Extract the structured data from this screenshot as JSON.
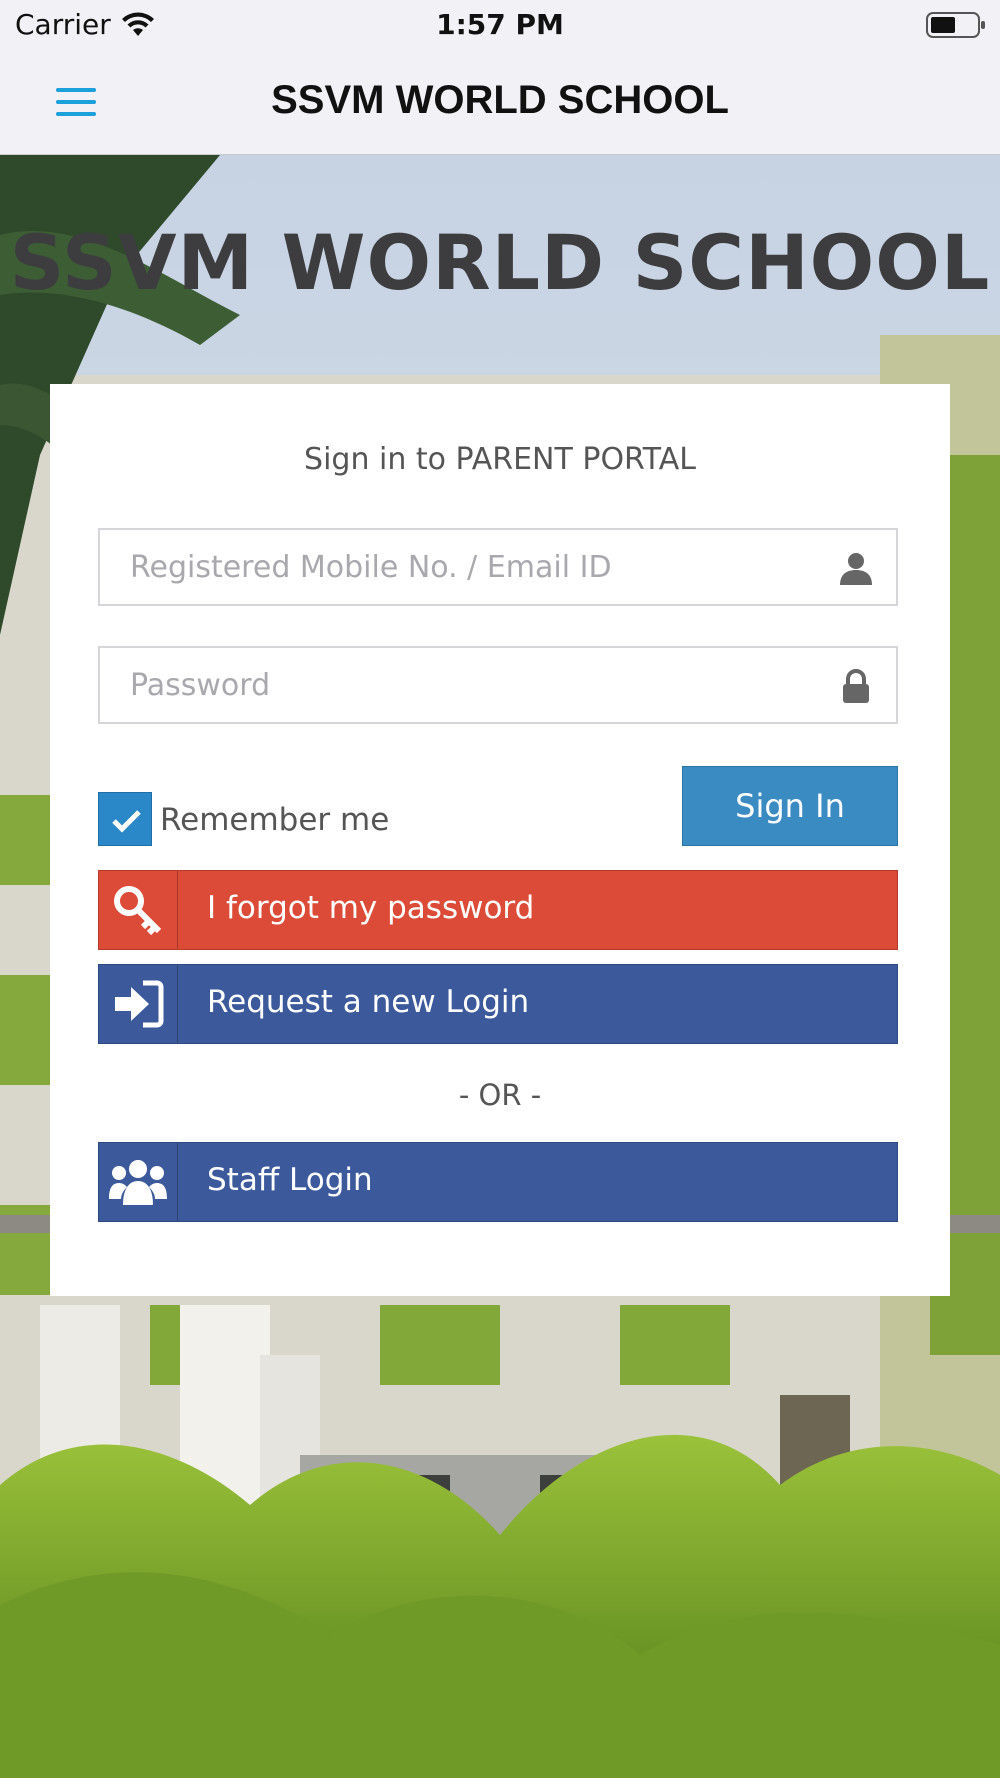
{
  "status_bar": {
    "carrier": "Carrier",
    "time": "1:57 PM"
  },
  "nav": {
    "title": "SSVM WORLD SCHOOL",
    "menu_icon": "hamburger-menu-icon"
  },
  "hero": {
    "title": "SSVM WORLD SCHOOL"
  },
  "login": {
    "heading": "Sign in to PARENT PORTAL",
    "username_placeholder": "Registered Mobile No. / Email ID",
    "username_icon": "user-icon",
    "password_placeholder": "Password",
    "password_icon": "lock-icon",
    "remember_label": "Remember me",
    "remember_checked": true,
    "signin_label": "Sign In",
    "forgot_label": "I forgot my password",
    "forgot_icon": "key-icon",
    "request_label": "Request a new Login",
    "request_icon": "sign-in-icon",
    "or_text": "- OR -",
    "staff_label": "Staff Login",
    "staff_icon": "users-icon"
  },
  "colors": {
    "accent": "#1ca0da",
    "signin": "#3a8bc2",
    "forgot": "#dc4b37",
    "request": "#3c5a9b",
    "staff": "#3c5a9b"
  }
}
